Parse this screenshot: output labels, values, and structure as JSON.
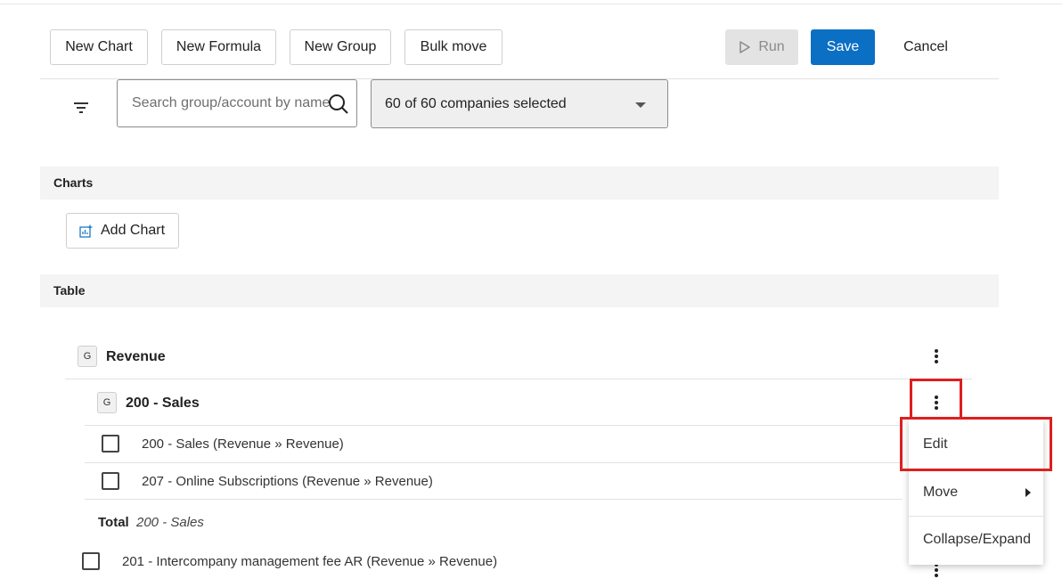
{
  "toolbar": {
    "new_chart": "New Chart",
    "new_formula": "New Formula",
    "new_group": "New Group",
    "bulk_move": "Bulk move",
    "run": "Run",
    "save": "Save",
    "cancel": "Cancel"
  },
  "filters": {
    "search_placeholder": "Search group/account by name",
    "company_selection": "60 of 60 companies selected"
  },
  "sections": {
    "charts_title": "Charts",
    "add_chart": "Add Chart",
    "table_title": "Table"
  },
  "table": {
    "groups": [
      {
        "badge": "G",
        "name": "Revenue"
      },
      {
        "badge": "G",
        "name": "200 - Sales"
      }
    ],
    "accounts": [
      {
        "label": "200 - Sales (Revenue » Revenue)"
      },
      {
        "label": "207 - Online Subscriptions (Revenue » Revenue)"
      },
      {
        "label": "201 - Intercompany management fee AR (Revenue » Revenue)"
      }
    ],
    "total_label": "Total",
    "total_group": "200 - Sales"
  },
  "context_menu": {
    "items": [
      "Edit",
      "Move",
      "Collapse/Expand"
    ]
  },
  "colors": {
    "primary": "#0b6fc4",
    "highlight": "#dd1f1f",
    "section_bg": "#f4f4f4"
  }
}
